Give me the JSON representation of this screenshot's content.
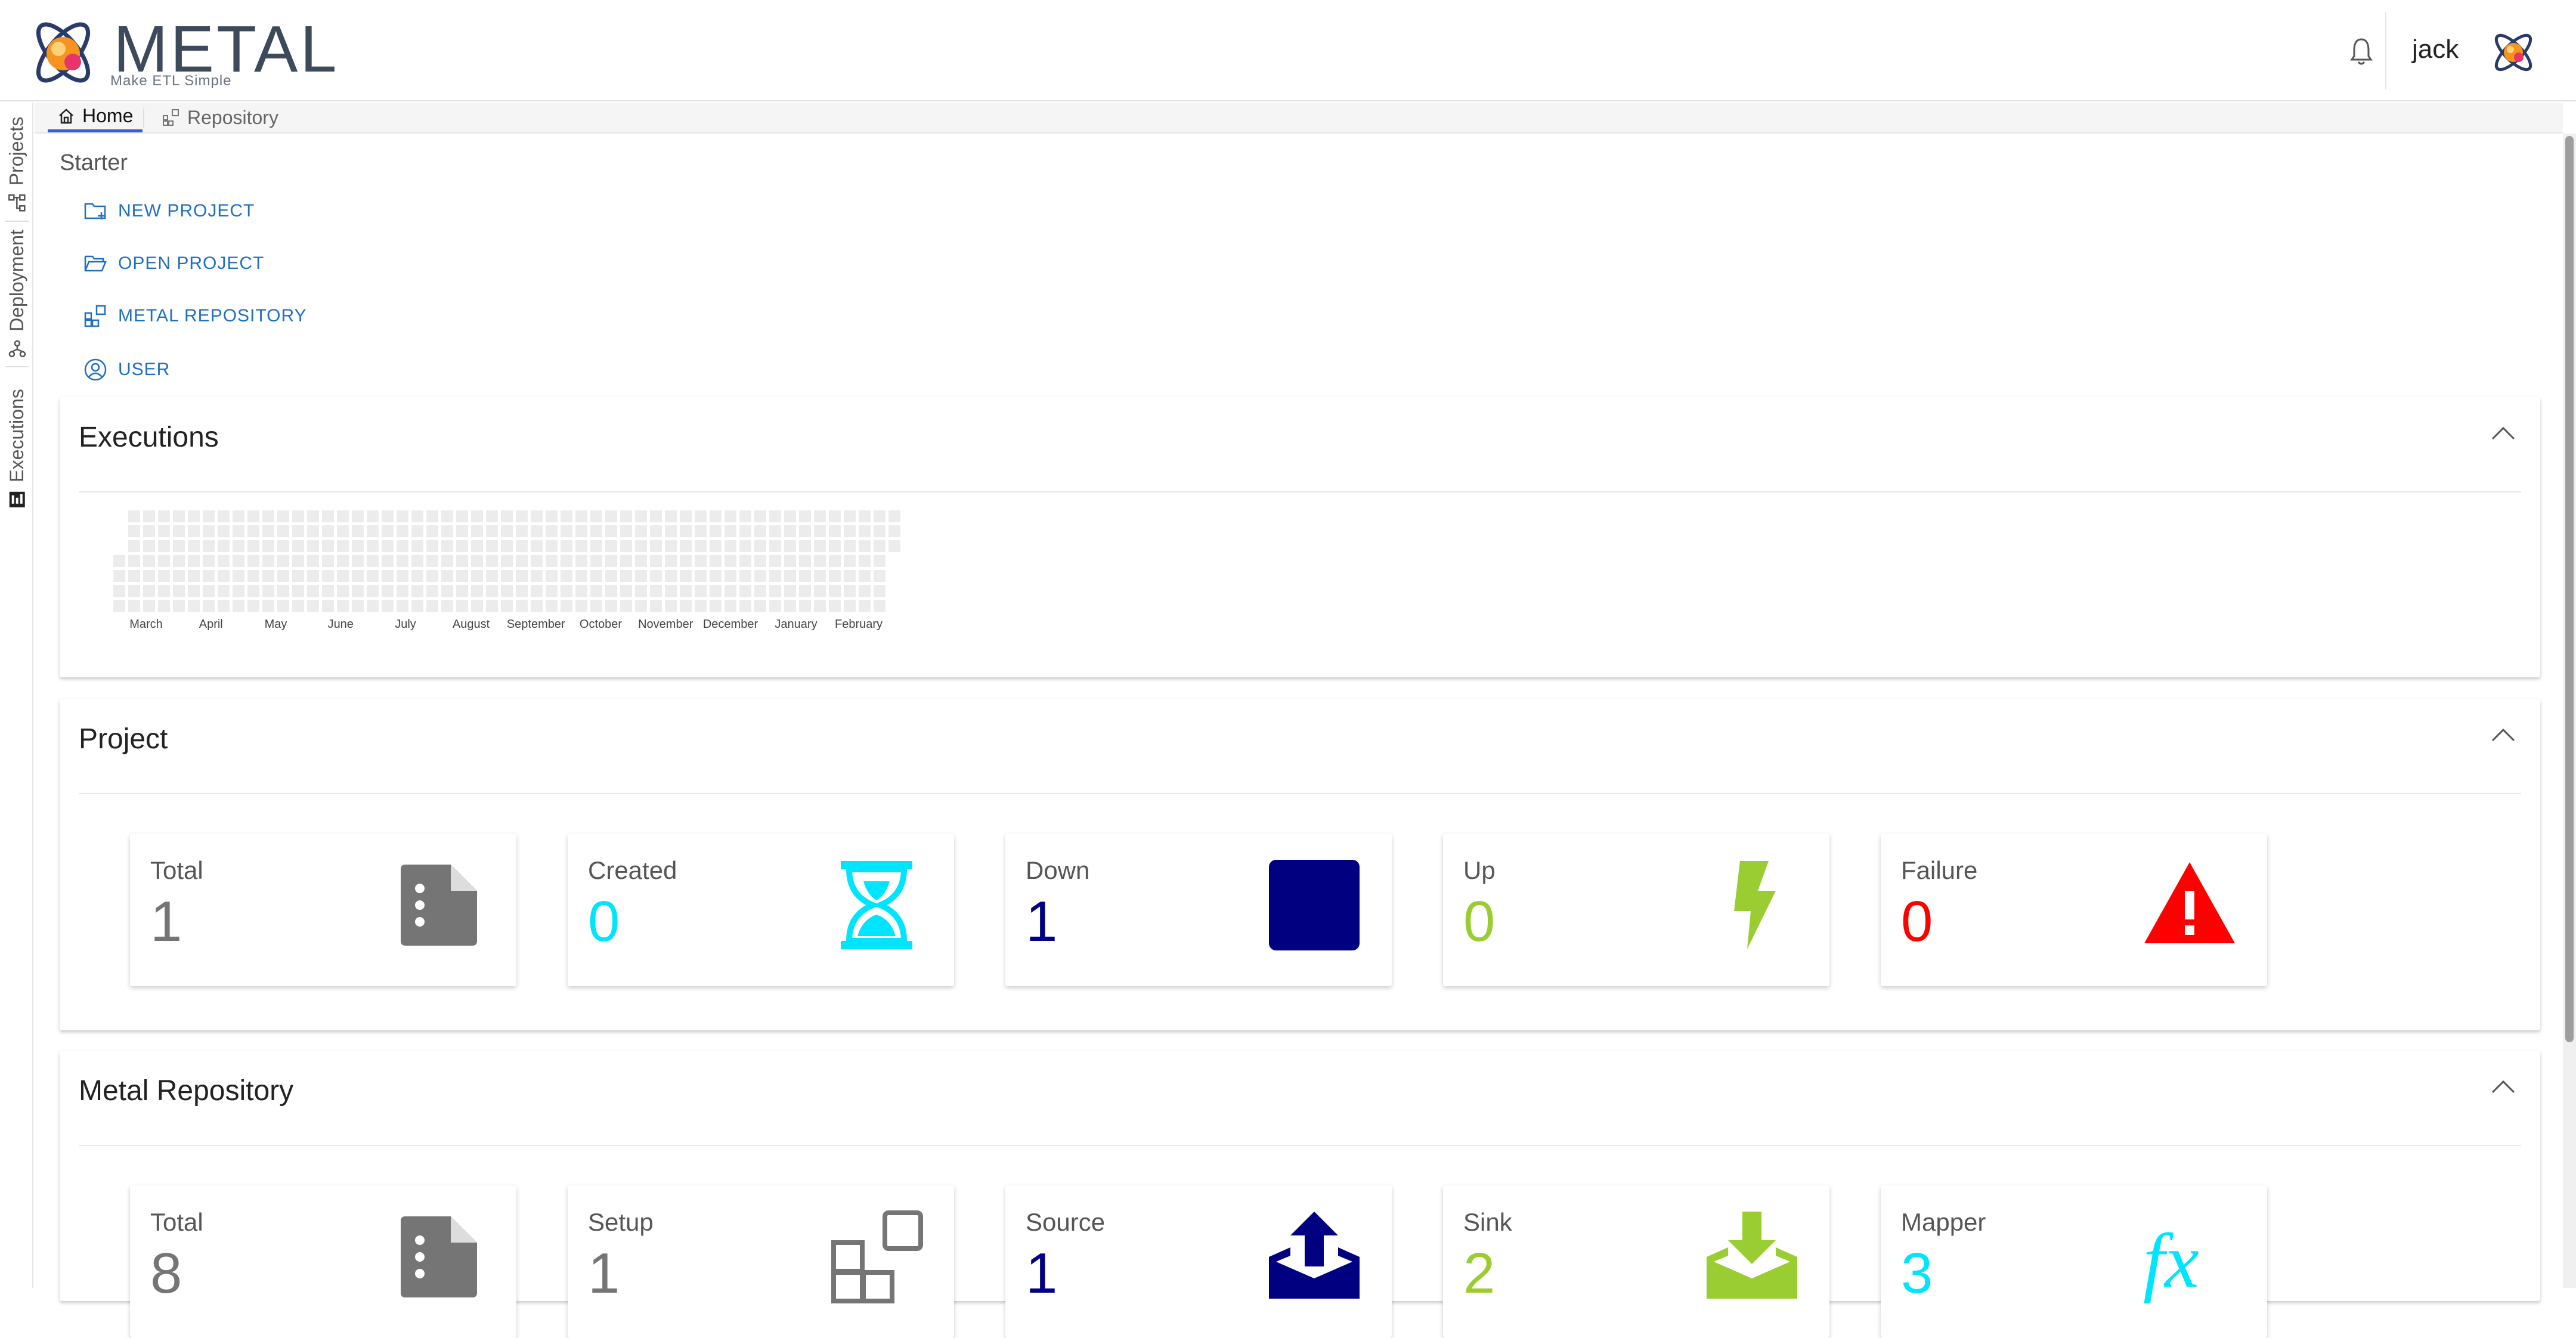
{
  "header": {
    "logo_text": "METAL",
    "logo_tagline": "Make ETL Simple",
    "username": "jack"
  },
  "sidebar": {
    "items": [
      {
        "label": "Projects"
      },
      {
        "label": "Deployment"
      },
      {
        "label": "Executions"
      }
    ]
  },
  "tabs": [
    {
      "label": "Home",
      "active": true
    },
    {
      "label": "Repository",
      "active": false
    }
  ],
  "starter": {
    "title": "Starter",
    "links": [
      {
        "label": "NEW PROJECT",
        "icon": "folder-plus-icon"
      },
      {
        "label": "OPEN PROJECT",
        "icon": "folder-open-icon"
      },
      {
        "label": "METAL REPOSITORY",
        "icon": "repository-icon"
      },
      {
        "label": "USER",
        "icon": "user-circle-icon"
      }
    ]
  },
  "executions": {
    "title": "Executions",
    "months": [
      "March",
      "April",
      "May",
      "June",
      "July",
      "August",
      "September",
      "October",
      "November",
      "December",
      "January",
      "February"
    ]
  },
  "project": {
    "title": "Project",
    "cards": [
      {
        "label": "Total",
        "value": "1",
        "color": "#757575",
        "icon": "file-icon"
      },
      {
        "label": "Created",
        "value": "0",
        "color": "#00e5ff",
        "icon": "hourglass-icon"
      },
      {
        "label": "Down",
        "value": "1",
        "color": "#000080",
        "icon": "square-icon"
      },
      {
        "label": "Up",
        "value": "0",
        "color": "#9acd32",
        "icon": "bolt-icon"
      },
      {
        "label": "Failure",
        "value": "0",
        "color": "#ff0000",
        "icon": "warning-icon"
      }
    ]
  },
  "repository": {
    "title": "Metal Repository",
    "cards": [
      {
        "label": "Total",
        "value": "8",
        "color": "#757575",
        "icon": "file-icon"
      },
      {
        "label": "Setup",
        "value": "1",
        "color": "#757575",
        "icon": "blocks-icon"
      },
      {
        "label": "Source",
        "value": "1",
        "color": "#000080",
        "icon": "upload-tray-icon"
      },
      {
        "label": "Sink",
        "value": "2",
        "color": "#9acd32",
        "icon": "download-tray-icon"
      },
      {
        "label": "Mapper",
        "value": "3",
        "color": "#00e5ff",
        "icon": "fx-icon"
      }
    ]
  }
}
